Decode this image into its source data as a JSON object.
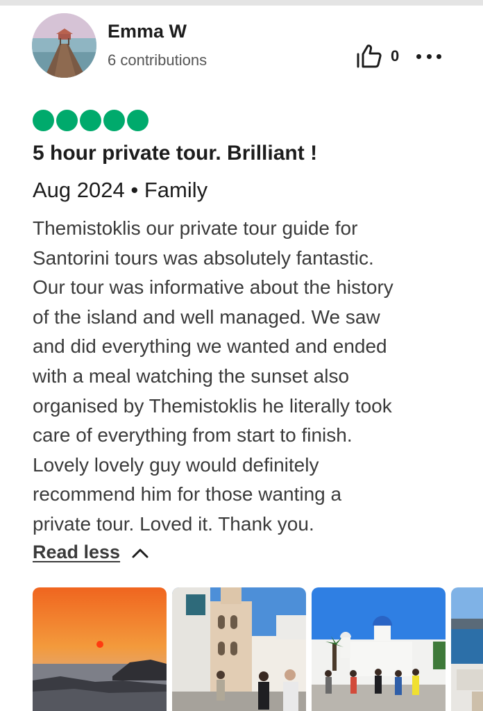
{
  "reviewer": {
    "name": "Emma W",
    "contributions": "6 contributions",
    "avatar_icon": "avatar-photo-pier"
  },
  "actions": {
    "helpful_icon": "thumbs-up-icon",
    "helpful_count": "0",
    "more_icon": "more-horizontal-icon"
  },
  "rating": {
    "value": 5,
    "max": 5,
    "color": "#00aa6c"
  },
  "review": {
    "title": "5 hour private tour. Brilliant !",
    "meta": "Aug 2024 • Family",
    "body_lines": [
      "Themistoklis our private tour guide for",
      "Santorini tours was absolutely fantastic.",
      "Our tour was informative about the history",
      "of the island and well managed. We saw",
      "and did everything we wanted and ended",
      "with a meal watching the sunset also",
      "organised by Themistoklis he literally took",
      "care of everything from start to finish.",
      "Lovely lovely guy would definitely",
      "recommend him for those wanting a",
      "private tour. Loved it. Thank you."
    ],
    "toggle_label": "Read less",
    "toggle_icon": "chevron-up-icon"
  },
  "photos": [
    {
      "subject": "sunset-over-sea-photo"
    },
    {
      "subject": "bell-tower-street-photo"
    },
    {
      "subject": "white-church-blue-dome-photo"
    },
    {
      "subject": "caldera-view-photo"
    }
  ]
}
